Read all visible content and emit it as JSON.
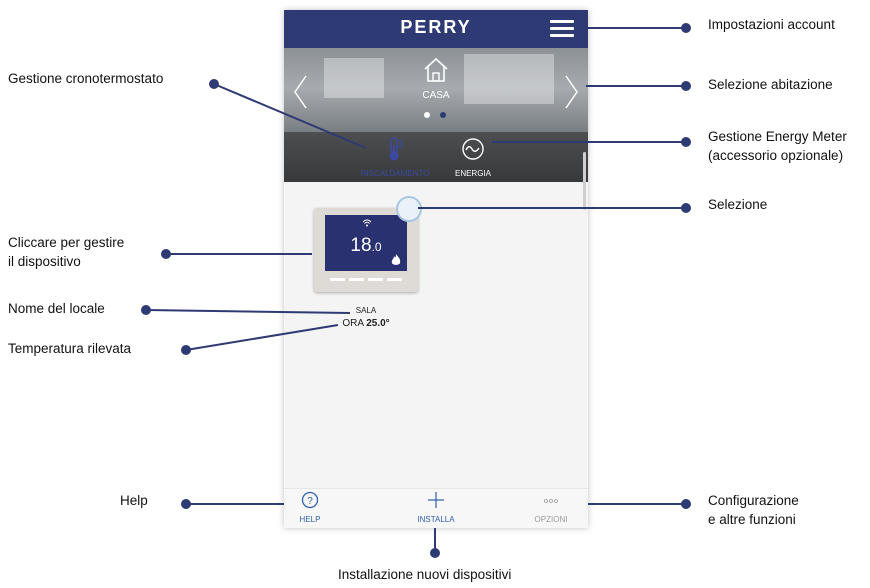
{
  "app": {
    "brand": "PERRY",
    "home": {
      "label": "CASA",
      "icon": "home-icon"
    },
    "functions": [
      {
        "label": "RISCALDAMENTO",
        "icon": "thermometer-icon",
        "color": "#3b4aa0"
      },
      {
        "label": "ENERGIA",
        "icon": "energy-wave-icon",
        "color": "#ffffff"
      }
    ],
    "device": {
      "temperature_int": "18",
      "temperature_dec": ".0"
    },
    "room": {
      "name": "SALA",
      "reading_prefix": "ORA",
      "reading_value": "25.0°"
    },
    "tabs": [
      {
        "label": "HELP",
        "icon": "help-circle-icon",
        "color": "#2e5fa8"
      },
      {
        "label": "INSTALLA",
        "icon": "plus-icon",
        "color": "#2e5fa8"
      },
      {
        "label": "OPZIONI",
        "icon": "more-dots-icon",
        "color": "#9a9a9a"
      }
    ],
    "colors": {
      "topbar": "#2e3a73",
      "accent": "#2e5fa8",
      "device_screen": "#2a3170",
      "callout_line": "#2e3a73"
    }
  },
  "callouts": {
    "account": "Impostazioni account",
    "cronotermostato": "Gestione cronotermostato",
    "abitazione": "Selezione abitazione",
    "energy_1": "Gestione Energy Meter",
    "energy_2": "(accessorio opzionale)",
    "selezione": "Selezione",
    "gestire_1": "Cliccare per gestire",
    "gestire_2": "il dispositivo",
    "nome": "Nome del locale",
    "temperatura": "Temperatura rilevata",
    "help": "Help",
    "config_1": "Configurazione",
    "config_2": "e altre funzioni",
    "installazione": "Installazione nuovi dispositivi"
  }
}
